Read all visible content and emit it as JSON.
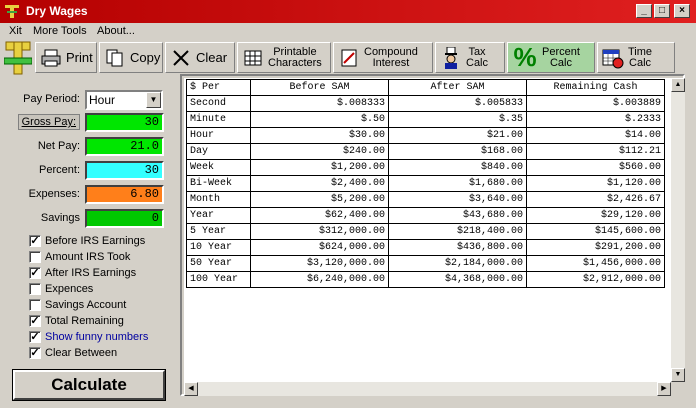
{
  "window": {
    "title": "Dry Wages"
  },
  "menu": {
    "items": [
      "Xit",
      "More Tools",
      "About..."
    ]
  },
  "toolbar": {
    "print": "Print",
    "copy": "Copy",
    "clear": "Clear",
    "printable_1": "Printable",
    "printable_2": "Characters",
    "compound_1": "Compound",
    "compound_2": "Interest",
    "tax_1": "Tax",
    "tax_2": "Calc",
    "percent_1": "Percent",
    "percent_2": "Calc",
    "time_1": "Time",
    "time_2": "Calc",
    "percent_glyph": "%"
  },
  "form": {
    "pay_period_label": "Pay Period:",
    "pay_period_value": "Hour",
    "gross_pay_label": "Gross Pay:",
    "gross_pay_value": "30",
    "net_pay_label": "Net Pay:",
    "net_pay_value": "21.0",
    "percent_label": "Percent:",
    "percent_value": "30",
    "expenses_label": "Expenses:",
    "expenses_value": "6.80",
    "savings_label": "Savings",
    "savings_value": "0"
  },
  "options": [
    {
      "label": "Before IRS Earnings",
      "checked": true,
      "check": "✓"
    },
    {
      "label": "Amount IRS Took",
      "checked": false,
      "check": ""
    },
    {
      "label": "After IRS Earnings",
      "checked": true,
      "check": "✓"
    },
    {
      "label": "Expences",
      "checked": false,
      "check": ""
    },
    {
      "label": "Savings Account",
      "checked": false,
      "check": ""
    },
    {
      "label": "Total Remaining",
      "checked": true,
      "check": "✓"
    },
    {
      "label": "Show funny numbers",
      "checked": true,
      "check": "✓"
    },
    {
      "label": "Clear Between",
      "checked": true,
      "check": "✓"
    }
  ],
  "calculate_label": "Calculate",
  "colors": {
    "gross": "#00e600",
    "net": "#00e600",
    "percent": "#33ffff",
    "expenses": "#ff7f1a",
    "savings": "#00c800"
  },
  "table": {
    "headers": [
      "$ Per",
      "Before SAM",
      "After  SAM",
      "Remaining Cash"
    ],
    "rows": [
      [
        "Second",
        "$.008333",
        "$.005833",
        "$.003889"
      ],
      [
        "Minute",
        "$.50",
        "$.35",
        "$.2333"
      ],
      [
        "Hour",
        "$30.00",
        "$21.00",
        "$14.00"
      ],
      [
        "Day",
        "$240.00",
        "$168.00",
        "$112.21"
      ],
      [
        "Week",
        "$1,200.00",
        "$840.00",
        "$560.00"
      ],
      [
        "Bi-Week",
        "$2,400.00",
        "$1,680.00",
        "$1,120.00"
      ],
      [
        "Month",
        "$5,200.00",
        "$3,640.00",
        "$2,426.67"
      ],
      [
        "Year",
        "$62,400.00",
        "$43,680.00",
        "$29,120.00"
      ],
      [
        "5 Year",
        "$312,000.00",
        "$218,400.00",
        "$145,600.00"
      ],
      [
        "10 Year",
        "$624,000.00",
        "$436,800.00",
        "$291,200.00"
      ],
      [
        "50 Year",
        "$3,120,000.00",
        "$2,184,000.00",
        "$1,456,000.00"
      ],
      [
        "100 Year",
        "$6,240,000.00",
        "$4,368,000.00",
        "$2,912,000.00"
      ]
    ]
  }
}
